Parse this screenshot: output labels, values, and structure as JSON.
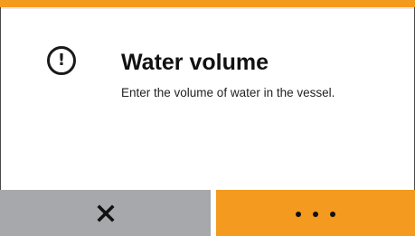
{
  "dialog": {
    "title": "Water volume",
    "message": "Enter the volume of water in the vessel.",
    "icon": "alert-circle-exclamation-icon",
    "alert_icon_glyph": "!"
  },
  "buttons": {
    "cancel": {
      "icon": "close-icon"
    },
    "more": {
      "icon": "more-dots-icon"
    }
  },
  "colors": {
    "accent": "#f49a1e",
    "cancel_bg": "#a6a8ab",
    "text": "#111111"
  }
}
